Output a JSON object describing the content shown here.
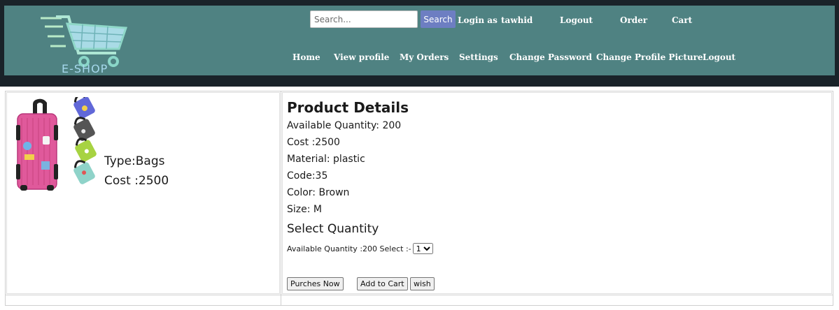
{
  "header": {
    "logo_text": "E-SHOP",
    "search": {
      "placeholder": "Search...",
      "button_label": "Search"
    },
    "login_as_label": "Login as",
    "username": "tawhid",
    "top_links": [
      "Logout",
      "Order",
      "Cart"
    ],
    "nav_links": [
      "Home",
      "View profile",
      "My Orders",
      "Settings",
      "Change Password",
      "Change Profile Picture",
      "Logout"
    ]
  },
  "product": {
    "type_label": "Type:Bags",
    "cost_label": "Cost :2500",
    "details_title": "Product Details",
    "details": [
      "Available Quantity: 200",
      "Cost :2500",
      "Material: plastic",
      "Code:35",
      "Color: Brown",
      "Size: M"
    ],
    "select_quantity_title": "Select Quantity",
    "available_select_label": "Available Quantity :200 Select :-",
    "quantity_selected": "1",
    "buttons": {
      "purchase": "Purches Now",
      "add_to_cart": "Add to Cart",
      "wish": "wish"
    }
  },
  "colors": {
    "navbar": "#4f8282",
    "topbar": "#1a2329",
    "search_button": "#6d7ec2"
  },
  "icons": [
    "shopping-cart-logo-icon",
    "luggage-tag-image"
  ]
}
